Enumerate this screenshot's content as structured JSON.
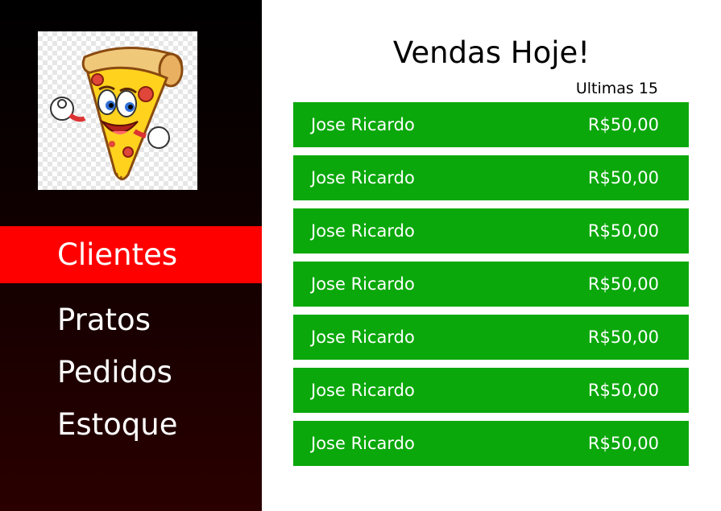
{
  "nav": {
    "items": [
      {
        "label": "Clientes",
        "active": true
      },
      {
        "label": "Pratos",
        "active": false
      },
      {
        "label": "Pedidos",
        "active": false
      },
      {
        "label": "Estoque",
        "active": false
      }
    ]
  },
  "main": {
    "title": "Vendas Hoje!",
    "subtitle": "Ultimas 15",
    "sales": [
      {
        "name": "Jose Ricardo",
        "amount": "R$50,00"
      },
      {
        "name": "Jose Ricardo",
        "amount": "R$50,00"
      },
      {
        "name": "Jose Ricardo",
        "amount": "R$50,00"
      },
      {
        "name": "Jose Ricardo",
        "amount": "R$50,00"
      },
      {
        "name": "Jose Ricardo",
        "amount": "R$50,00"
      },
      {
        "name": "Jose Ricardo",
        "amount": "R$50,00"
      },
      {
        "name": "Jose Ricardo",
        "amount": "R$50,00"
      }
    ]
  },
  "colors": {
    "active_nav": "#ff0000",
    "sale_row": "#0aa80a",
    "sidebar_top": "#000000",
    "sidebar_bottom": "#2a0000"
  },
  "logo": {
    "icon": "pizza-mascot-icon"
  }
}
